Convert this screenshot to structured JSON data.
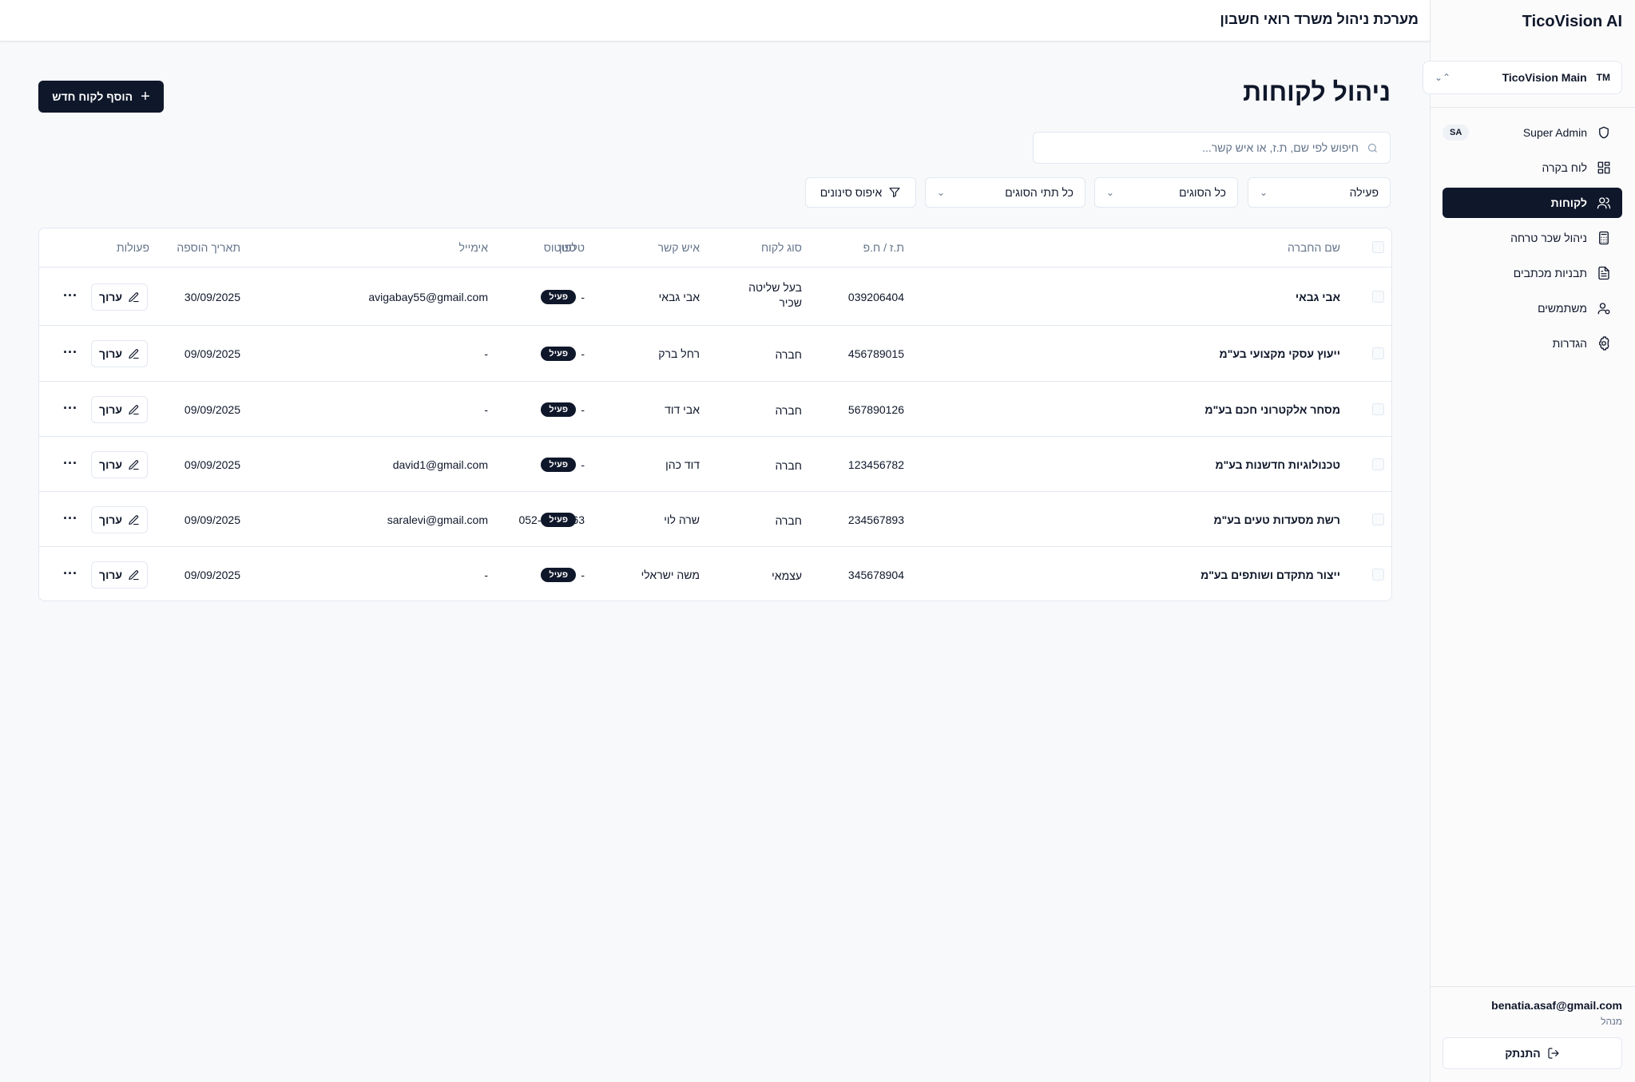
{
  "sidebar": {
    "brand": "TicoVision AI",
    "org": {
      "badge": "TM",
      "name": "TicoVision Main"
    },
    "items": [
      {
        "label": "Super Admin",
        "badge": "SA"
      },
      {
        "label": "לוח בקרה"
      },
      {
        "label": "לקוחות"
      },
      {
        "label": "ניהול שכר טרחה"
      },
      {
        "label": "תבניות מכתבים"
      },
      {
        "label": "משתמשים"
      },
      {
        "label": "הגדרות"
      }
    ],
    "user": {
      "email": "benatia.asaf@gmail.com",
      "role": "מנהל"
    },
    "logout_label": "התנתק"
  },
  "topbar": {
    "title": "מערכת ניהול משרד רואי חשבון"
  },
  "page": {
    "title": "ניהול לקוחות",
    "add_button": "הוסף לקוח חדש",
    "search_placeholder": "חיפוש לפי שם, ת.ז, או איש קשר...",
    "filters": {
      "status": "פעילה",
      "types": "כל הסוגים",
      "subtypes": "כל תתי הסוגים",
      "reset": "איפוס סינונים"
    }
  },
  "table": {
    "headers": {
      "company": "שם החברה",
      "id": "ת.ז / ח.פ",
      "type": "סוג לקוח",
      "contact": "איש קשר",
      "phone": "טלפון",
      "email": "אימייל",
      "status": "סטטוס",
      "date": "תאריך הוספה",
      "actions": "פעולות"
    },
    "edit_label": "ערוך",
    "more_label": "···",
    "rows": [
      {
        "company": "אבי גבאי",
        "id": "039206404",
        "type": "בעל שליטה שכיר",
        "contact": "אבי גבאי",
        "phone": "-",
        "email": "avigabay55@gmail.com",
        "status": "פעיל",
        "date": "30/09/2025"
      },
      {
        "company": "ייעוץ עסקי מקצועי בע\"מ",
        "id": "456789015",
        "type": "חברה",
        "contact": "רחל ברק",
        "phone": "-",
        "email": "-",
        "status": "פעיל",
        "date": "09/09/2025"
      },
      {
        "company": "מסחר אלקטרוני חכם בע\"מ",
        "id": "567890126",
        "type": "חברה",
        "contact": "אבי דוד",
        "phone": "-",
        "email": "-",
        "status": "פעיל",
        "date": "09/09/2025"
      },
      {
        "company": "טכנולוגיות חדשנות בע\"מ",
        "id": "123456782",
        "type": "חברה",
        "contact": "דוד כהן",
        "phone": "-",
        "email": "david1@gmail.com",
        "status": "פעיל",
        "date": "09/09/2025"
      },
      {
        "company": "רשת מסעדות טעים בע\"מ",
        "id": "234567893",
        "type": "חברה",
        "contact": "שרה לוי",
        "phone": "052-6633663",
        "email": "saralevi@gmail.com",
        "status": "פעיל",
        "date": "09/09/2025"
      },
      {
        "company": "ייצור מתקדם ושותפים בע\"מ",
        "id": "345678904",
        "type": "עצמאי",
        "contact": "משה ישראלי",
        "phone": "-",
        "email": "-",
        "status": "פעיל",
        "date": "09/09/2025"
      }
    ]
  }
}
